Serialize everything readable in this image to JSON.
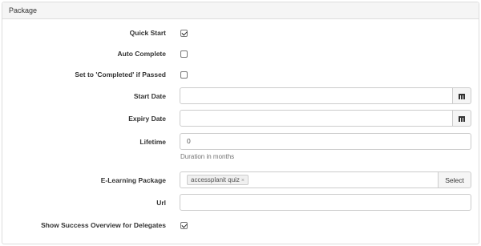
{
  "panel": {
    "title": "Package"
  },
  "fields": {
    "quick_start": {
      "label": "Quick Start",
      "checked": true
    },
    "auto_complete": {
      "label": "Auto Complete",
      "checked": false
    },
    "set_completed": {
      "label": "Set to 'Completed' if Passed",
      "checked": false
    },
    "start_date": {
      "label": "Start Date",
      "value": ""
    },
    "expiry_date": {
      "label": "Expiry Date",
      "value": ""
    },
    "lifetime": {
      "label": "Lifetime",
      "value": "0",
      "help": "Duration in months"
    },
    "elearning_package": {
      "label": "E-Learning Package",
      "tag": "accessplanit quiz",
      "tag_remove": "×",
      "select_label": "Select"
    },
    "url": {
      "label": "Url",
      "value": ""
    },
    "show_success": {
      "label": "Show Success Overview for Delegates",
      "checked": true
    }
  }
}
